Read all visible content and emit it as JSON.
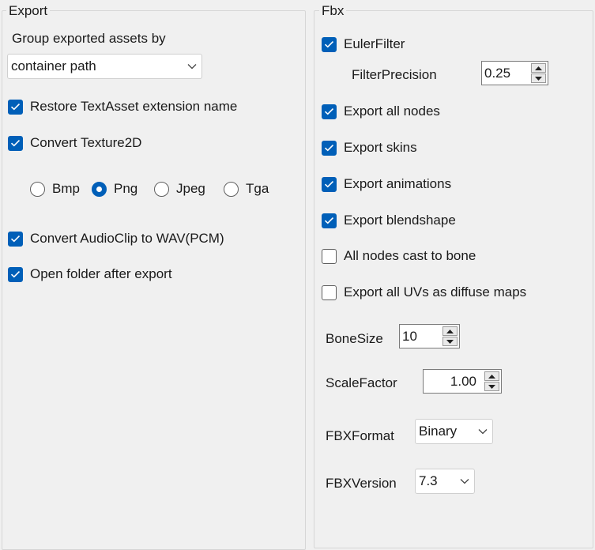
{
  "export": {
    "title": "Export",
    "group_by_label": "Group exported assets by",
    "group_by_value": "container path",
    "restore_textasset_label": "Restore TextAsset extension name",
    "restore_textasset_checked": true,
    "convert_texture_label": "Convert Texture2D",
    "convert_texture_checked": true,
    "image_formats": [
      {
        "label": "Bmp",
        "selected": false
      },
      {
        "label": "Png",
        "selected": true
      },
      {
        "label": "Jpeg",
        "selected": false
      },
      {
        "label": "Tga",
        "selected": false
      }
    ],
    "convert_audio_label": "Convert AudioClip to WAV(PCM)",
    "convert_audio_checked": true,
    "open_folder_label": "Open folder after export",
    "open_folder_checked": true
  },
  "fbx": {
    "title": "Fbx",
    "euler_filter_label": "EulerFilter",
    "euler_filter_checked": true,
    "filter_precision_label": "FilterPrecision",
    "filter_precision_value": "0.25",
    "export_all_nodes_label": "Export all nodes",
    "export_all_nodes_checked": true,
    "export_skins_label": "Export skins",
    "export_skins_checked": true,
    "export_animations_label": "Export animations",
    "export_animations_checked": true,
    "export_blendshape_label": "Export blendshape",
    "export_blendshape_checked": true,
    "all_nodes_bone_label": "All nodes cast to bone",
    "all_nodes_bone_checked": false,
    "export_uvs_label": "Export all UVs as diffuse maps",
    "export_uvs_checked": false,
    "bone_size_label": "BoneSize",
    "bone_size_value": "10",
    "scale_factor_label": "ScaleFactor",
    "scale_factor_value": "1.00",
    "fbx_format_label": "FBXFormat",
    "fbx_format_value": "Binary",
    "fbx_version_label": "FBXVersion",
    "fbx_version_value": "7.3"
  },
  "colors": {
    "accent": "#005fb8",
    "background": "#f0f0f0"
  },
  "icons": {
    "checkbox": "check-icon",
    "dropdown": "chevron-down-icon",
    "spin_up": "arrow-up-icon",
    "spin_down": "arrow-down-icon"
  }
}
